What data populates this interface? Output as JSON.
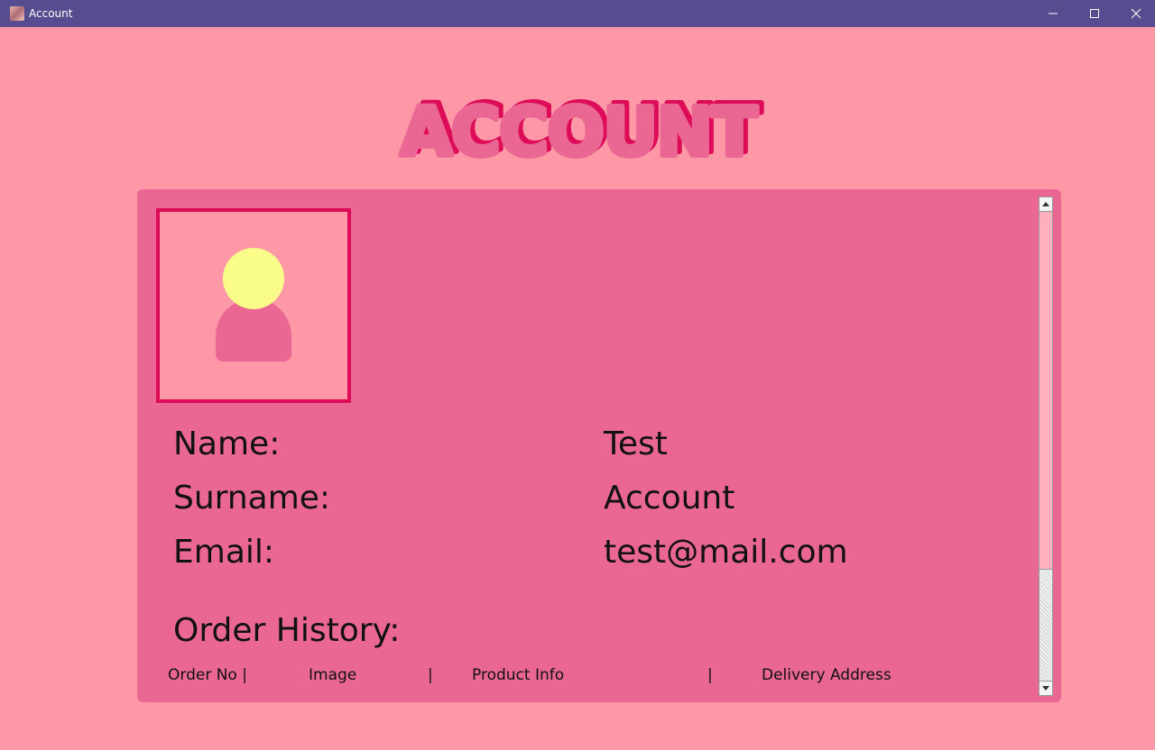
{
  "window": {
    "title": "Account",
    "controls": [
      "minimize-icon",
      "maximize-icon",
      "close-icon"
    ]
  },
  "header": {
    "title": "ACCOUNT"
  },
  "profile": {
    "avatar_icon": "user-avatar-icon",
    "fields": [
      {
        "label": "Name:",
        "value": "Test"
      },
      {
        "label": "Surname:",
        "value": "Account"
      },
      {
        "label": "Email:",
        "value": "test@mail.com"
      }
    ]
  },
  "orders": {
    "heading": "Order History:",
    "columns": [
      "Order No |",
      "Image",
      "|",
      "Product Info",
      "|",
      "Delivery Address"
    ]
  },
  "colors": {
    "background": "#fe98a6",
    "panel": "#e96792",
    "accent": "#de0b59",
    "avatar_head": "#fafc8a",
    "titlebar": "#554d8f"
  }
}
